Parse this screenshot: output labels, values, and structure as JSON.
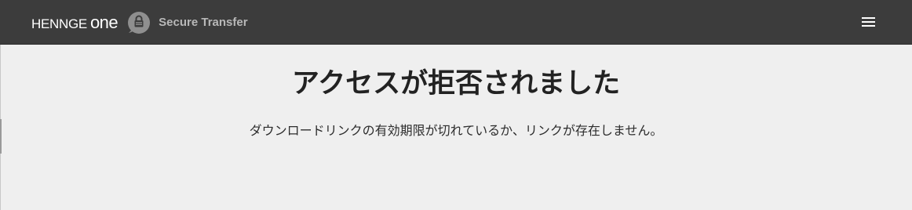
{
  "header": {
    "logo_main": "HENNGE",
    "logo_one": "one",
    "app_icon": "secure-transfer-lock-icon",
    "app_name": "Secure Transfer",
    "menu_icon": "hamburger-menu-icon"
  },
  "main": {
    "title": "アクセスが拒否されました",
    "message": "ダウンロードリンクの有効期限が切れているか、リンクが存在しません。"
  },
  "colors": {
    "header_bg": "#3c3c3c",
    "page_bg": "#efefef",
    "app_icon_bg": "#8f8f8f",
    "app_name": "#b8b8b8"
  }
}
